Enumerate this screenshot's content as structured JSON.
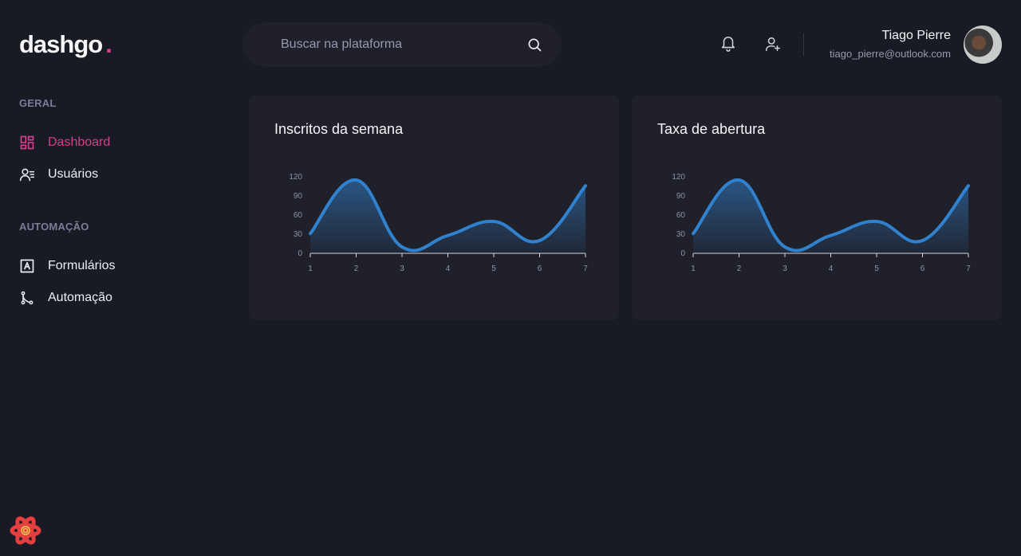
{
  "brand": {
    "name": "dashgo",
    "dot": ".",
    "accent": "#d53f8c"
  },
  "search": {
    "placeholder": "Buscar na plataforma",
    "icon": "search-icon"
  },
  "header": {
    "icons": [
      "bell-icon",
      "user-plus-icon"
    ]
  },
  "profile": {
    "name": "Tiago Pierre",
    "email": "tiago_pierre@outlook.com"
  },
  "sidebar": {
    "sections": [
      {
        "title": "GERAL",
        "items": [
          {
            "label": "Dashboard",
            "icon": "dashboard-icon",
            "active": true
          },
          {
            "label": "Usuários",
            "icon": "users-icon",
            "active": false
          }
        ]
      },
      {
        "title": "AUTOMAÇÃO",
        "items": [
          {
            "label": "Formulários",
            "icon": "form-icon",
            "active": false
          },
          {
            "label": "Automação",
            "icon": "git-merge-icon",
            "active": false
          }
        ]
      }
    ]
  },
  "chart_data": [
    {
      "type": "area",
      "title": "Inscritos da semana",
      "x": [
        1,
        2,
        3,
        4,
        5,
        6,
        7
      ],
      "series": [
        {
          "values": [
            31,
            115,
            10,
            28,
            50,
            20,
            106
          ]
        }
      ],
      "yticks": [
        0,
        30,
        60,
        90,
        120
      ],
      "ylim": [
        0,
        120
      ],
      "line_color": "#3182ce",
      "grid": false
    },
    {
      "type": "area",
      "title": "Taxa de abertura",
      "x": [
        1,
        2,
        3,
        4,
        5,
        6,
        7
      ],
      "series": [
        {
          "values": [
            31,
            115,
            10,
            28,
            50,
            20,
            106
          ]
        }
      ],
      "yticks": [
        0,
        30,
        60,
        90,
        120
      ],
      "ylim": [
        0,
        120
      ],
      "line_color": "#3182ce",
      "grid": false
    }
  ]
}
